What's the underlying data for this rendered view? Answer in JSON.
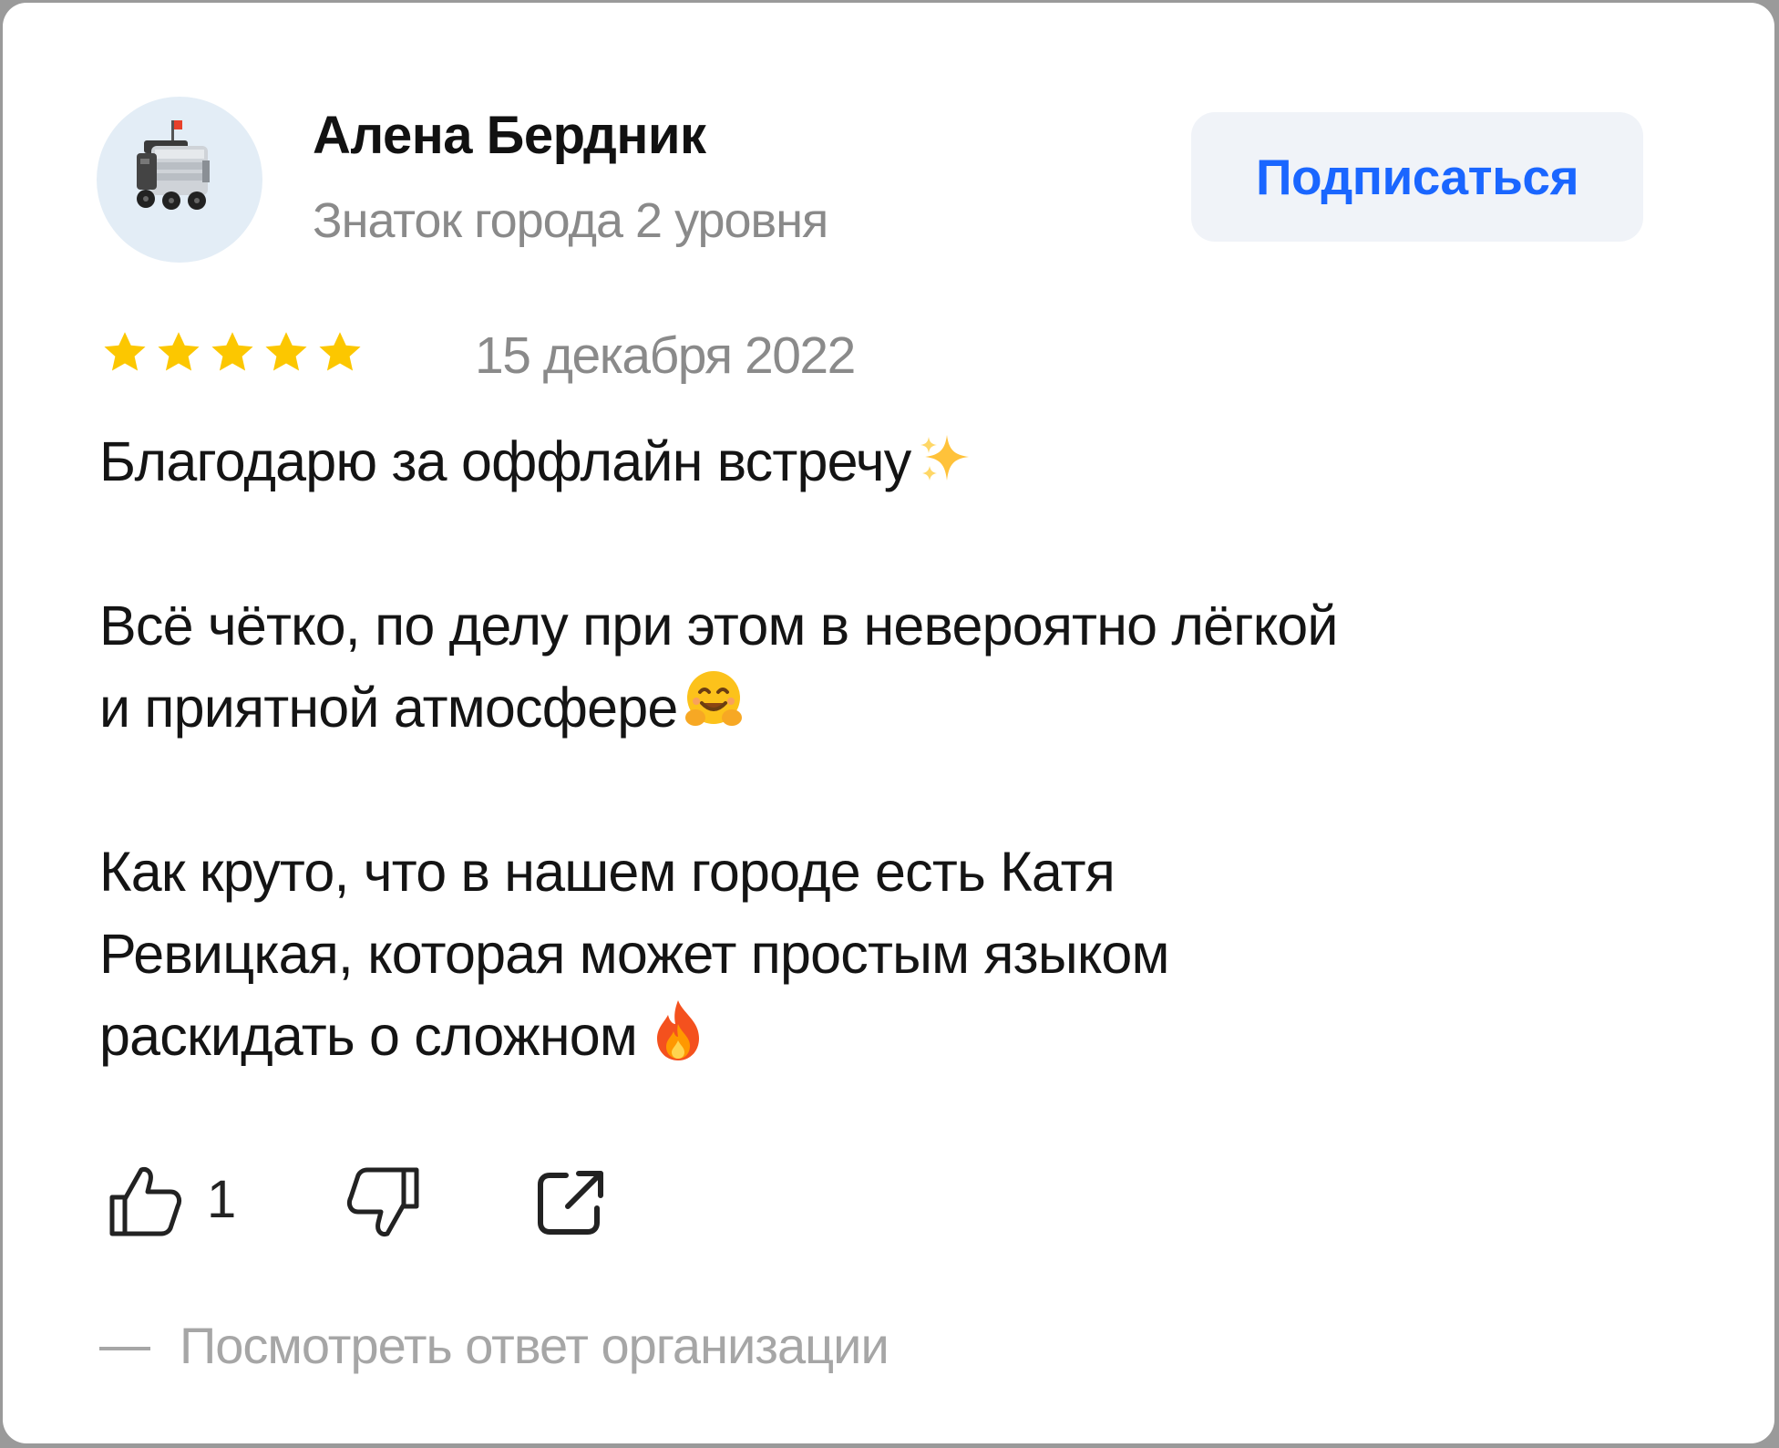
{
  "review": {
    "author_name": "Алена Бердник",
    "author_level": "Знаток города 2 уровня",
    "subscribe_label": "Подписаться",
    "rating": 5,
    "rating_max": 5,
    "date": "15 декабря 2022",
    "text_lines": [
      "Благодарю за оффлайн встречу",
      "Всё чётко, по делу при этом в невероятно лёгкой",
      "и приятной атмосфере",
      "Как круто, что в нашем городе есть Катя",
      "Ревицкая, которая может простым языком",
      "раскидать о сложном"
    ],
    "likes": "1",
    "reply_link": "Посмотреть ответ организации"
  },
  "colors": {
    "accent": "#1a66ff",
    "star": "#fcc700",
    "muted_text": "#8a8a8a",
    "button_bg": "#f0f3f8"
  },
  "icons": [
    "robot-avatar",
    "star-icon",
    "sparkles-emoji",
    "hugging-face-emoji",
    "fire-emoji",
    "thumbs-up-icon",
    "thumbs-down-icon",
    "share-icon"
  ]
}
